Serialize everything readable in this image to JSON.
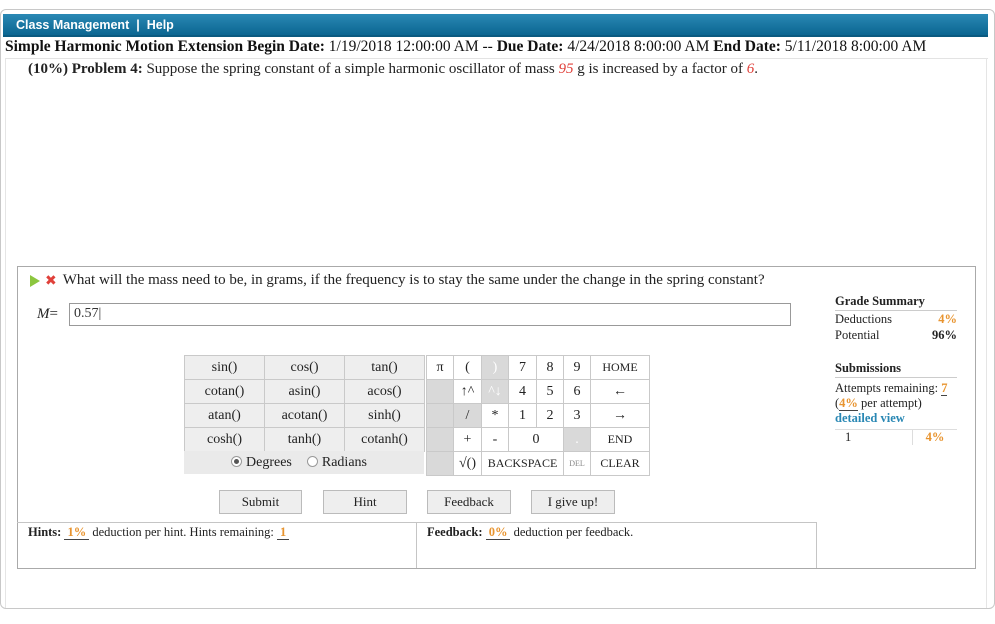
{
  "topbar": {
    "class_management": "Class Management",
    "separator": "|",
    "help": "Help"
  },
  "assignment": {
    "name": "Simple Harmonic Motion Extension",
    "begin_label": "Begin Date:",
    "begin": "1/19/2018 12:00:00 AM",
    "dash": "--",
    "due_label": "Due Date:",
    "due": "4/24/2018 8:00:00 AM",
    "end_label": "End Date:",
    "end": "5/11/2018 8:00:00 AM"
  },
  "problem": {
    "weight": "(10%)",
    "label": "Problem 4:",
    "text_a": "Suppose the spring constant of a simple harmonic oscillator of mass",
    "mass": "95",
    "text_b": "g is increased by a factor of",
    "factor": "6",
    "text_c": "."
  },
  "question": {
    "text": "What will the mass need to be, in grams, if the frequency is to stay the same under the change in the spring constant?",
    "var": "M",
    "eq": "=",
    "value": "0.57|"
  },
  "functions": [
    [
      "sin()",
      "cos()",
      "tan()"
    ],
    [
      "cotan()",
      "asin()",
      "acos()"
    ],
    [
      "atan()",
      "acotan()",
      "sinh()"
    ],
    [
      "cosh()",
      "tanh()",
      "cotanh()"
    ]
  ],
  "angle": {
    "degrees": "Degrees",
    "radians": "Radians",
    "selected": "Degrees"
  },
  "keypad": {
    "pi": "π",
    "lparen": "(",
    "rparen": ")",
    "up": "↑^",
    "down": "^↓",
    "slash": "/",
    "star": "*",
    "plus": "+",
    "minus": "-",
    "sqrt": "√()",
    "backspace": "BACKSPACE",
    "del": "DEL",
    "clear": "CLEAR",
    "home": "HOME",
    "left": "←",
    "right": "→",
    "end": "END",
    "digits": [
      "7",
      "8",
      "9",
      "4",
      "5",
      "6",
      "1",
      "2",
      "3",
      "0",
      "."
    ]
  },
  "buttons": {
    "submit": "Submit",
    "hint": "Hint",
    "feedback": "Feedback",
    "give_up": "I give up!"
  },
  "hints": {
    "label": "Hints:",
    "pct": "1%",
    "text": "deduction per hint. Hints remaining:",
    "remaining": "1"
  },
  "feedback": {
    "label": "Feedback:",
    "pct": "0%",
    "text": "deduction per feedback."
  },
  "grade": {
    "title": "Grade Summary",
    "deductions_label": "Deductions",
    "deductions": "4%",
    "potential_label": "Potential",
    "potential": "96%"
  },
  "submissions": {
    "title": "Submissions",
    "attempts_label": "Attempts remaining:",
    "attempts": "7",
    "per_pct": "4%",
    "per_open": "(",
    "per_text": "per attempt)",
    "detail": "detailed view",
    "rows": [
      {
        "n": "1",
        "pct": "4%"
      }
    ]
  },
  "colors": {
    "topbar": "#0b6691",
    "accent": "#e8942f",
    "red": "#e0403a",
    "link": "#2a88b4"
  }
}
